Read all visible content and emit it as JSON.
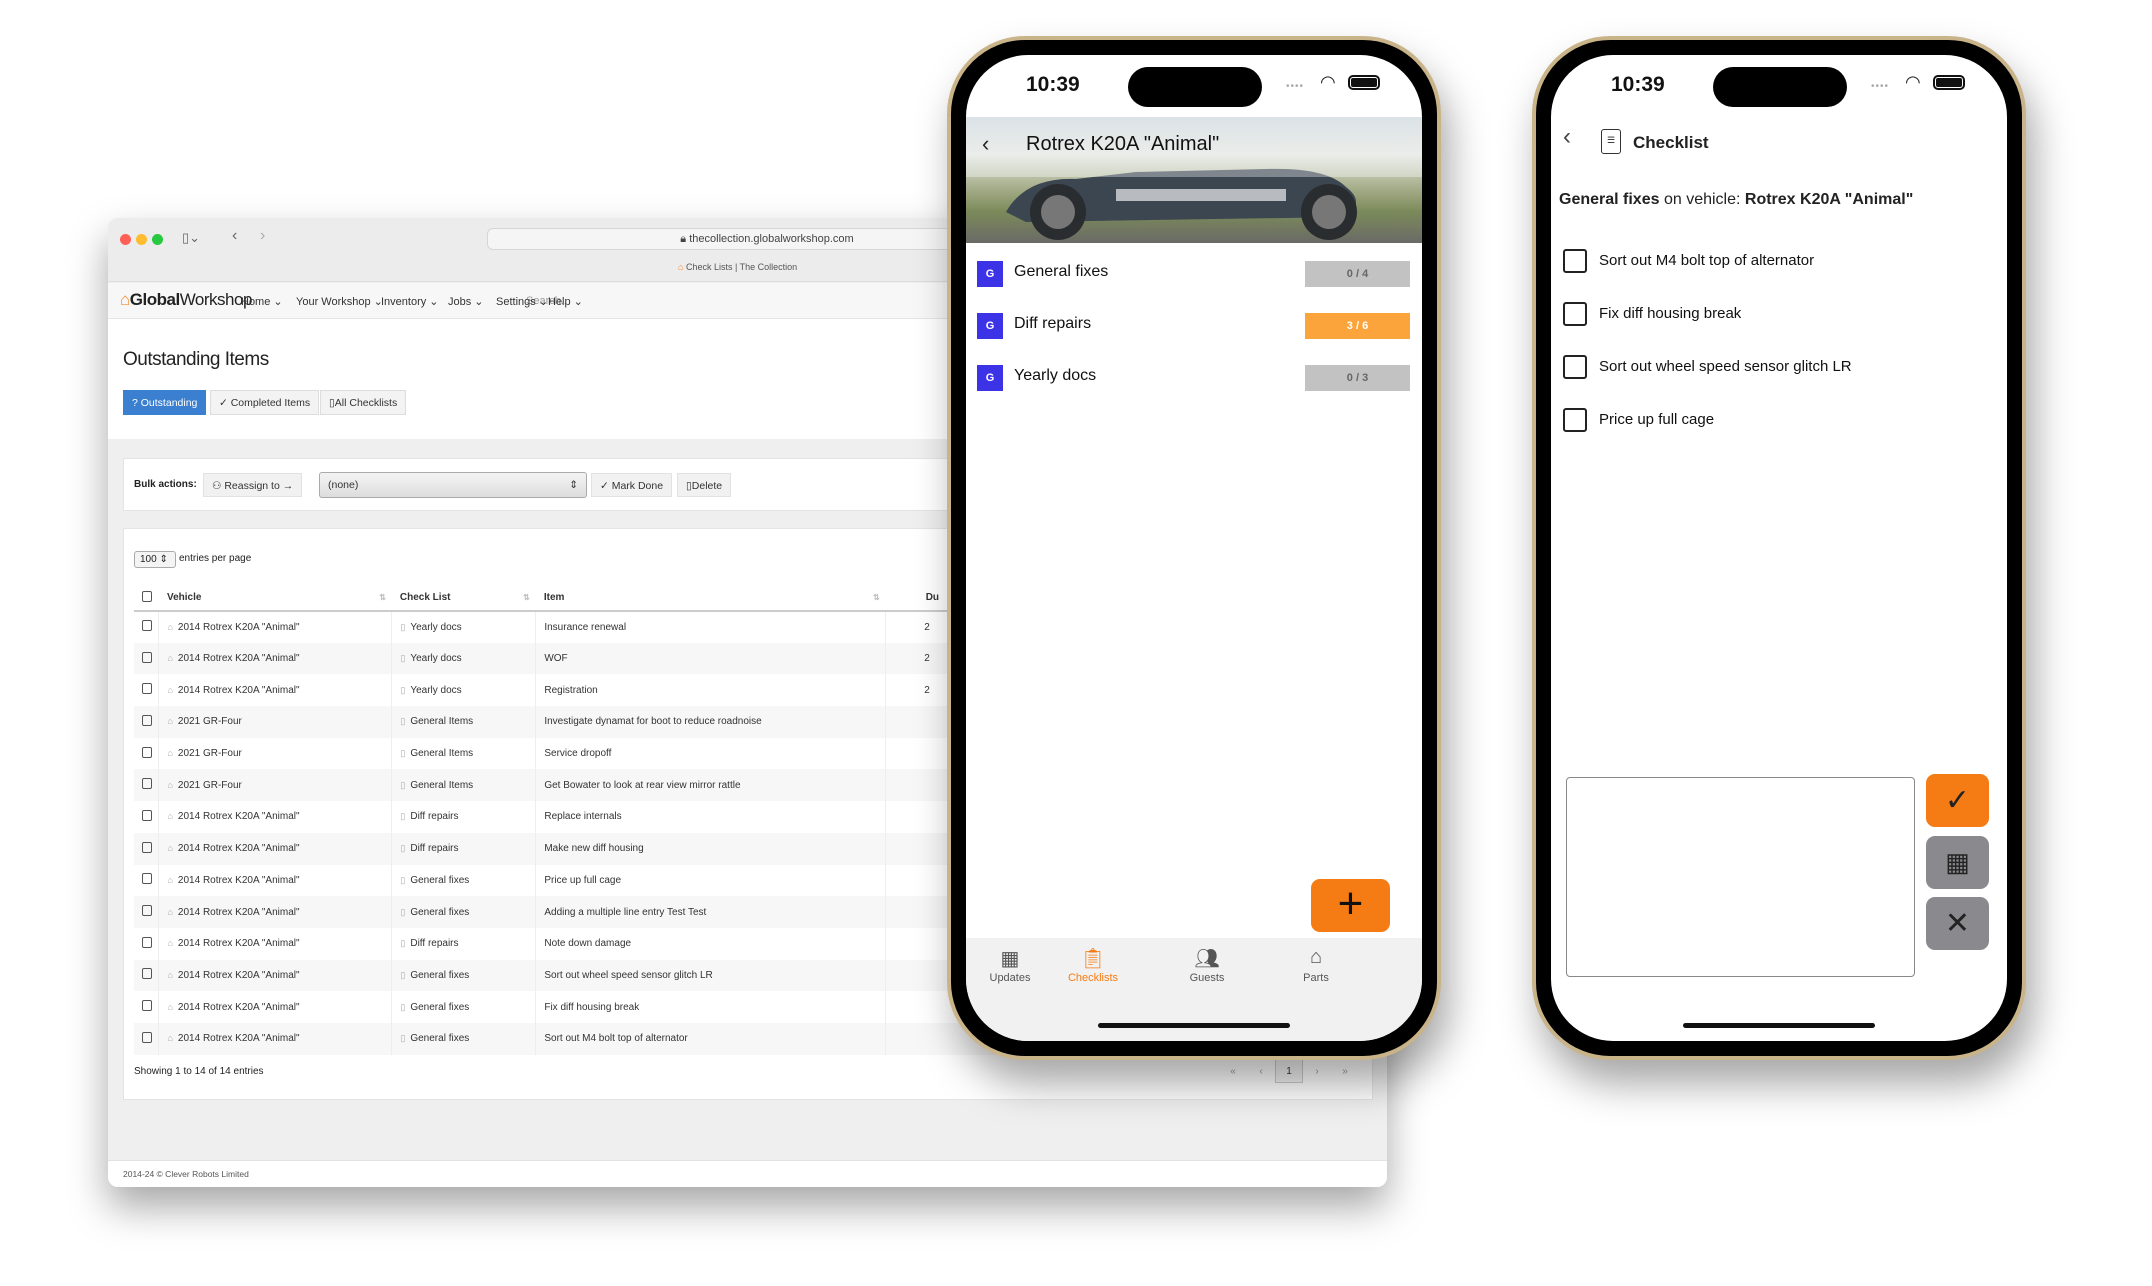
{
  "browser": {
    "url": "thecollection.globalworkshop.com",
    "tab_title": "Check Lists | The Collection",
    "logo_bold": "Global",
    "logo_light": "Workshop",
    "nav": [
      "Home",
      "Your Workshop",
      "Inventory",
      "Jobs",
      "Settings",
      "Help"
    ],
    "search_placeholder": "Search..",
    "page_title": "Outstanding Items",
    "tabs": [
      "? Outstanding",
      "✓ Completed Items",
      "All Checklists"
    ],
    "bulk": {
      "label": "Bulk actions:",
      "reassign": "Reassign to →",
      "select_value": "(none)",
      "mark_done": "✓ Mark Done",
      "delete": "Delete"
    },
    "entries": {
      "value": "100",
      "label": "entries per page"
    },
    "columns": [
      "Vehicle",
      "Check List",
      "Item",
      "Du"
    ],
    "rows": [
      [
        "2014 Rotrex K20A \"Animal\"",
        "Yearly docs",
        "Insurance renewal",
        "2"
      ],
      [
        "2014 Rotrex K20A \"Animal\"",
        "Yearly docs",
        "WOF",
        "2"
      ],
      [
        "2014 Rotrex K20A \"Animal\"",
        "Yearly docs",
        "Registration",
        "2"
      ],
      [
        "2021 GR-Four",
        "General Items",
        "Investigate dynamat for boot to reduce roadnoise",
        ""
      ],
      [
        "2021 GR-Four",
        "General Items",
        "Service dropoff",
        ""
      ],
      [
        "2021 GR-Four",
        "General Items",
        "Get Bowater to look at rear view mirror rattle",
        ""
      ],
      [
        "2014 Rotrex K20A \"Animal\"",
        "Diff repairs",
        "Replace internals",
        ""
      ],
      [
        "2014 Rotrex K20A \"Animal\"",
        "Diff repairs",
        "Make new diff housing",
        ""
      ],
      [
        "2014 Rotrex K20A \"Animal\"",
        "General fixes",
        "Price up full cage",
        ""
      ],
      [
        "2014 Rotrex K20A \"Animal\"",
        "General fixes",
        "Adding a multiple line entry Test Test",
        ""
      ],
      [
        "2014 Rotrex K20A \"Animal\"",
        "Diff repairs",
        "Note down damage",
        ""
      ],
      [
        "2014 Rotrex K20A \"Animal\"",
        "General fixes",
        "Sort out wheel speed sensor glitch LR",
        ""
      ],
      [
        "2014 Rotrex K20A \"Animal\"",
        "General fixes",
        "Fix diff housing break",
        ""
      ],
      [
        "2014 Rotrex K20A \"Animal\"",
        "General fixes",
        "Sort out M4 bolt top of alternator",
        ""
      ]
    ],
    "showing": "Showing 1 to 14 of 14 entries",
    "pagination": [
      "«",
      "‹",
      "1",
      "›",
      "»"
    ],
    "footer": "2014-24 © Clever Robots Limited"
  },
  "phone1": {
    "time": "10:39",
    "title": "Rotrex K20A \"Animal\"",
    "checklists": [
      {
        "badge": "G",
        "name": "General fixes",
        "progress": "0 / 4",
        "done": 0,
        "total": 4
      },
      {
        "badge": "G",
        "name": "Diff repairs",
        "progress": "3 / 6",
        "done": 3,
        "total": 6
      },
      {
        "badge": "G",
        "name": "Yearly docs",
        "progress": "0 / 3",
        "done": 0,
        "total": 3
      }
    ],
    "tabs": [
      {
        "label": "Updates",
        "icon": "grid-icon"
      },
      {
        "label": "Checklists",
        "icon": "clipboard-icon",
        "active": true
      },
      {
        "label": "Guests",
        "icon": "people-icon"
      },
      {
        "label": "Parts",
        "icon": "garage-icon"
      }
    ],
    "accent": "#f57c14",
    "badge_color": "#3c32e6"
  },
  "phone2": {
    "time": "10:39",
    "title": "Checklist",
    "subtitle_list": "General fixes",
    "subtitle_mid": " on vehicle: ",
    "subtitle_vehicle": "Rotrex K20A \"Animal\"",
    "items": [
      "Sort out M4 bolt top of alternator",
      "Fix diff housing break",
      "Sort out wheel speed sensor glitch LR",
      "Price up full cage"
    ],
    "note_value": ""
  }
}
